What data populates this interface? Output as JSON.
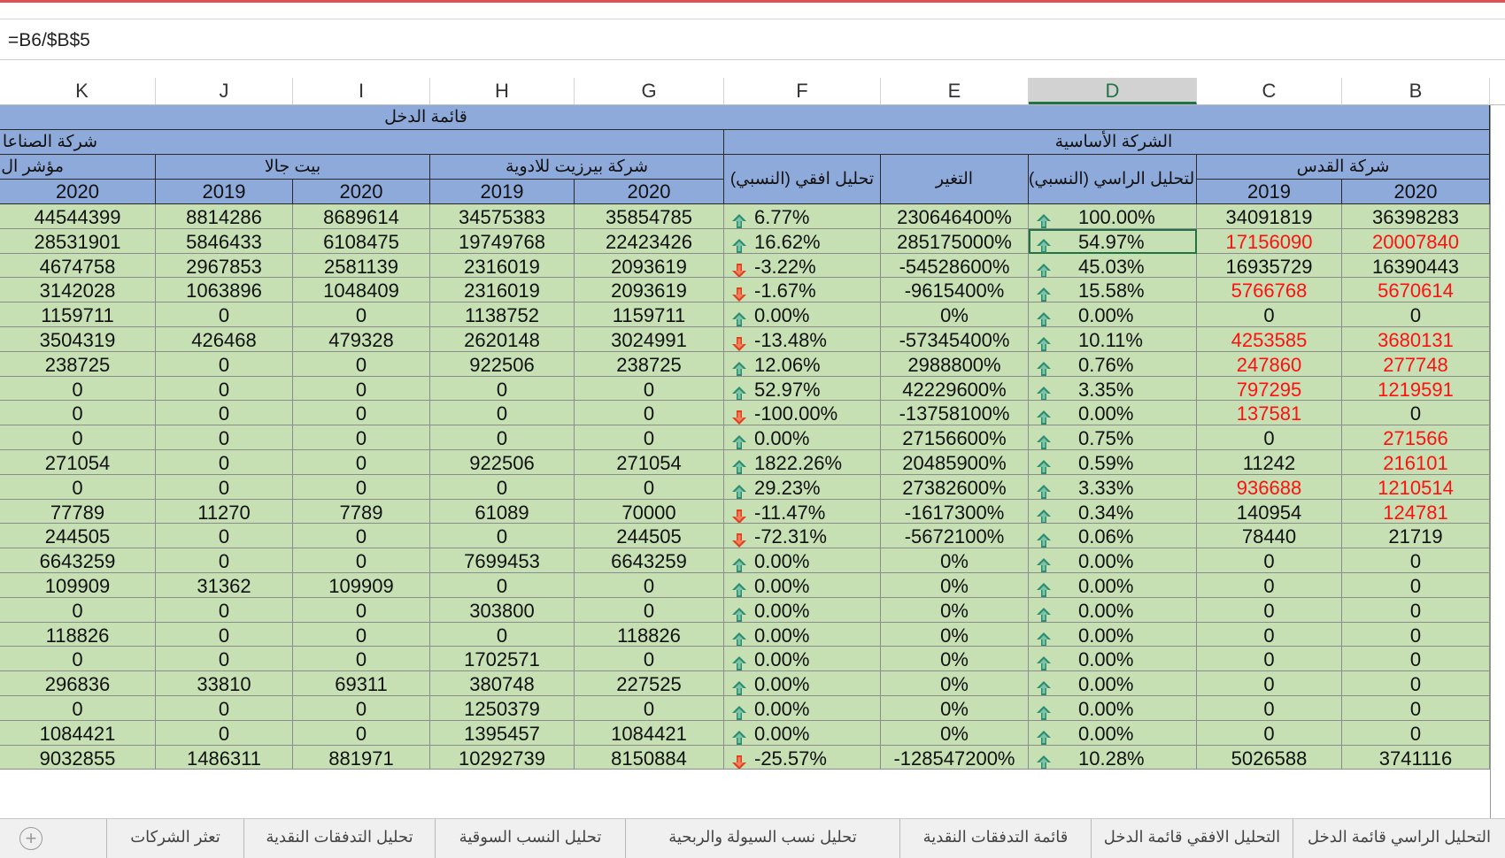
{
  "formula_bar": {
    "text": "=B6/$B$5"
  },
  "columns": [
    {
      "id": "K",
      "label": "K"
    },
    {
      "id": "J",
      "label": "J"
    },
    {
      "id": "I",
      "label": "I"
    },
    {
      "id": "H",
      "label": "H"
    },
    {
      "id": "G",
      "label": "G"
    },
    {
      "id": "F",
      "label": "F"
    },
    {
      "id": "E",
      "label": "E"
    },
    {
      "id": "D",
      "label": "D",
      "selected": true
    },
    {
      "id": "C",
      "label": "C"
    },
    {
      "id": "B",
      "label": "B"
    }
  ],
  "headers": {
    "income_statement": "قائمة الدخل",
    "industries_company": "شركة الصناعا",
    "base_company": "الشركة الأساسية",
    "indicator": "مؤشر ال",
    "beit_jala": "بيت جالا",
    "birzeit": "شركة بيرزيت للادوية",
    "horizontal_analysis": "تحليل افقي (النسبي)",
    "change": "التغير",
    "vertical_analysis": "التحليل الراسي (النسبي)",
    "quds": "شركة القدس",
    "years": {
      "K": "2020",
      "J": "2019",
      "I": "2020",
      "H": "2019",
      "G": "2020",
      "C": "2019",
      "B": "2020"
    }
  },
  "rows": [
    {
      "K": "44544399",
      "J": "8814286",
      "I": "8689614",
      "H": "34575383",
      "G": "35854785",
      "F": "6.77%",
      "F_dir": "up",
      "E": "230646400%",
      "D": "100.00%",
      "D_dir": "up",
      "C": "34091819",
      "B": "36398283",
      "C_red": false,
      "B_red": false
    },
    {
      "K": "28531901",
      "J": "5846433",
      "I": "6108475",
      "H": "19749768",
      "G": "22423426",
      "F": "16.62%",
      "F_dir": "up",
      "E": "285175000%",
      "D": "54.97%",
      "D_dir": "up",
      "C": "17156090",
      "B": "20007840",
      "C_red": true,
      "B_red": true
    },
    {
      "K": "4674758",
      "J": "2967853",
      "I": "2581139",
      "H": "2316019",
      "G": "2093619",
      "F": "-3.22%",
      "F_dir": "down",
      "E": "-54528600%",
      "D": "45.03%",
      "D_dir": "up",
      "C": "16935729",
      "B": "16390443",
      "C_red": false,
      "B_red": false
    },
    {
      "K": "3142028",
      "J": "1063896",
      "I": "1048409",
      "H": "2316019",
      "G": "2093619",
      "F": "-1.67%",
      "F_dir": "down",
      "E": "-9615400%",
      "D": "15.58%",
      "D_dir": "up",
      "C": "5766768",
      "B": "5670614",
      "C_red": true,
      "B_red": true
    },
    {
      "K": "1159711",
      "J": "0",
      "I": "0",
      "H": "1138752",
      "G": "1159711",
      "F": "0.00%",
      "F_dir": "up",
      "E": "0%",
      "D": "0.00%",
      "D_dir": "up",
      "C": "0",
      "B": "0",
      "C_red": false,
      "B_red": false
    },
    {
      "K": "3504319",
      "J": "426468",
      "I": "479328",
      "H": "2620148",
      "G": "3024991",
      "F": "-13.48%",
      "F_dir": "down",
      "E": "-57345400%",
      "D": "10.11%",
      "D_dir": "up",
      "C": "4253585",
      "B": "3680131",
      "C_red": true,
      "B_red": true
    },
    {
      "K": "238725",
      "J": "0",
      "I": "0",
      "H": "922506",
      "G": "238725",
      "F": "12.06%",
      "F_dir": "up",
      "E": "2988800%",
      "D": "0.76%",
      "D_dir": "up",
      "C": "247860",
      "B": "277748",
      "C_red": true,
      "B_red": true
    },
    {
      "K": "0",
      "J": "0",
      "I": "0",
      "H": "0",
      "G": "0",
      "F": "52.97%",
      "F_dir": "up",
      "E": "42229600%",
      "D": "3.35%",
      "D_dir": "up",
      "C": "797295",
      "B": "1219591",
      "C_red": true,
      "B_red": true
    },
    {
      "K": "0",
      "J": "0",
      "I": "0",
      "H": "0",
      "G": "0",
      "F": "-100.00%",
      "F_dir": "down",
      "E": "-13758100%",
      "D": "0.00%",
      "D_dir": "up",
      "C": "137581",
      "B": "0",
      "C_red": true,
      "B_red": false
    },
    {
      "K": "0",
      "J": "0",
      "I": "0",
      "H": "0",
      "G": "0",
      "F": "0.00%",
      "F_dir": "up",
      "E": "27156600%",
      "D": "0.75%",
      "D_dir": "up",
      "C": "0",
      "B": "271566",
      "C_red": false,
      "B_red": true
    },
    {
      "K": "271054",
      "J": "0",
      "I": "0",
      "H": "922506",
      "G": "271054",
      "F": "1822.26%",
      "F_dir": "up",
      "E": "20485900%",
      "D": "0.59%",
      "D_dir": "up",
      "C": "11242",
      "B": "216101",
      "C_red": false,
      "B_red": true
    },
    {
      "K": "0",
      "J": "0",
      "I": "0",
      "H": "0",
      "G": "0",
      "F": "29.23%",
      "F_dir": "up",
      "E": "27382600%",
      "D": "3.33%",
      "D_dir": "up",
      "C": "936688",
      "B": "1210514",
      "C_red": true,
      "B_red": true
    },
    {
      "K": "77789",
      "J": "11270",
      "I": "7789",
      "H": "61089",
      "G": "70000",
      "F": "-11.47%",
      "F_dir": "down",
      "E": "-1617300%",
      "D": "0.34%",
      "D_dir": "up",
      "C": "140954",
      "B": "124781",
      "C_red": false,
      "B_red": true
    },
    {
      "K": "244505",
      "J": "0",
      "I": "0",
      "H": "0",
      "G": "244505",
      "F": "-72.31%",
      "F_dir": "down",
      "E": "-5672100%",
      "D": "0.06%",
      "D_dir": "up",
      "C": "78440",
      "B": "21719",
      "C_red": false,
      "B_red": false
    },
    {
      "K": "6643259",
      "J": "0",
      "I": "0",
      "H": "7699453",
      "G": "6643259",
      "F": "0.00%",
      "F_dir": "up",
      "E": "0%",
      "D": "0.00%",
      "D_dir": "up",
      "C": "0",
      "B": "0",
      "C_red": false,
      "B_red": false
    },
    {
      "K": "109909",
      "J": "31362",
      "I": "109909",
      "H": "0",
      "G": "0",
      "F": "0.00%",
      "F_dir": "up",
      "E": "0%",
      "D": "0.00%",
      "D_dir": "up",
      "C": "0",
      "B": "0",
      "C_red": false,
      "B_red": false
    },
    {
      "K": "0",
      "J": "0",
      "I": "0",
      "H": "303800",
      "G": "0",
      "F": "0.00%",
      "F_dir": "up",
      "E": "0%",
      "D": "0.00%",
      "D_dir": "up",
      "C": "0",
      "B": "0",
      "C_red": false,
      "B_red": false
    },
    {
      "K": "118826",
      "J": "0",
      "I": "0",
      "H": "0",
      "G": "118826",
      "F": "0.00%",
      "F_dir": "up",
      "E": "0%",
      "D": "0.00%",
      "D_dir": "up",
      "C": "0",
      "B": "0",
      "C_red": false,
      "B_red": false
    },
    {
      "K": "0",
      "J": "0",
      "I": "0",
      "H": "1702571",
      "G": "0",
      "F": "0.00%",
      "F_dir": "up",
      "E": "0%",
      "D": "0.00%",
      "D_dir": "up",
      "C": "0",
      "B": "0",
      "C_red": false,
      "B_red": false
    },
    {
      "K": "296836",
      "J": "33810",
      "I": "69311",
      "H": "380748",
      "G": "227525",
      "F": "0.00%",
      "F_dir": "up",
      "E": "0%",
      "D": "0.00%",
      "D_dir": "up",
      "C": "0",
      "B": "0",
      "C_red": false,
      "B_red": false
    },
    {
      "K": "0",
      "J": "0",
      "I": "0",
      "H": "1250379",
      "G": "0",
      "F": "0.00%",
      "F_dir": "up",
      "E": "0%",
      "D": "0.00%",
      "D_dir": "up",
      "C": "0",
      "B": "0",
      "C_red": false,
      "B_red": false
    },
    {
      "K": "1084421",
      "J": "0",
      "I": "0",
      "H": "1395457",
      "G": "1084421",
      "F": "0.00%",
      "F_dir": "up",
      "E": "0%",
      "D": "0.00%",
      "D_dir": "up",
      "C": "0",
      "B": "0",
      "C_red": false,
      "B_red": false
    },
    {
      "K": "9032855",
      "J": "1486311",
      "I": "881971",
      "H": "10292739",
      "G": "8150884",
      "F": "-25.57%",
      "F_dir": "down",
      "E": "-128547200%",
      "D": "10.28%",
      "D_dir": "up",
      "C": "5026588",
      "B": "3741116",
      "C_red": false,
      "B_red": false
    }
  ],
  "selected_cell": {
    "row": 1,
    "col": "D"
  },
  "colors": {
    "header_blue": "#8eaadb",
    "data_green": "#c6e0b4",
    "negative_red": "#ff1010",
    "arrow_up": "#2e8b6e",
    "arrow_down": "#e0401a",
    "selection": "#217346"
  },
  "icons": {
    "up": "arrow-up-icon",
    "down": "arrow-down-icon",
    "add": "plus-circle-icon"
  },
  "sheet_tabs": [
    "التحليل الراسي قائمة الدخل",
    "التحليل الافقي قائمة الدخل",
    "قائمة التدفقات النقدية",
    "تحليل نسب السيولة والربحية",
    "تحليل النسب السوقية",
    "تحليل التدفقات النقدية",
    "تعثر الشركات"
  ]
}
